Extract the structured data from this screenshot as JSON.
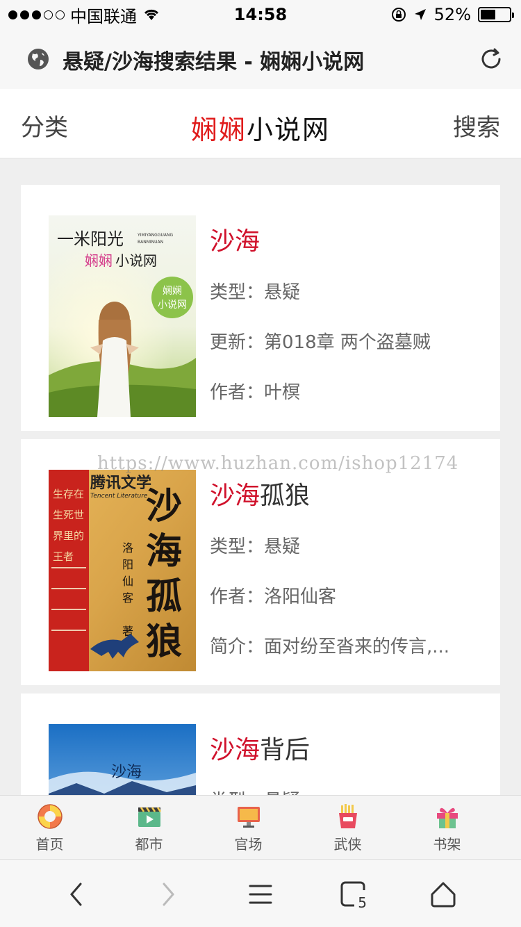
{
  "status_bar": {
    "carrier": "中国联通",
    "time": "14:58",
    "battery": "52%",
    "battery_level": 0.52
  },
  "address_bar": {
    "title": "悬疑/沙海搜索结果 - 娴娴小说网"
  },
  "header": {
    "left_label": "分类",
    "right_label": "搜索",
    "logo_red": "娴娴",
    "logo_black": "小说网"
  },
  "watermark": "https://www.huzhan.com/ishop12174",
  "results": [
    {
      "title_kw": "沙海",
      "title_rest": "",
      "line1": "类型：悬疑",
      "line2": "更新：第018章 两个盗墓贼",
      "line3": "作者：叶榠",
      "cover": {
        "brand_small": "一米阳光",
        "brand_en": "YIMIYANGGUANG BANMINUAN",
        "logo": "娴娴小说网",
        "badge": "娴娴小说网"
      }
    },
    {
      "title_kw": "沙海",
      "title_rest": "孤狼",
      "line1": "类型：悬疑",
      "line2": "作者：洛阳仙客",
      "line3": "简介：面对纷至沓来的传言,...",
      "cover": {
        "publisher": "腾讯文学",
        "publisher_en": "Tencent Literature",
        "big_text": "沙海孤狼",
        "author": "洛阳仙客",
        "author_suffix": "著",
        "side_text": "生存在生死世界里的王者"
      }
    },
    {
      "title_kw": "沙海",
      "title_rest": "背后",
      "line1": "类型：悬疑",
      "cover": {
        "text": "沙海"
      }
    }
  ],
  "tabbar": {
    "items": [
      {
        "label": "首页",
        "icon": "lifebuoy-icon"
      },
      {
        "label": "都市",
        "icon": "film-clapper-icon"
      },
      {
        "label": "官场",
        "icon": "monitor-icon"
      },
      {
        "label": "武侠",
        "icon": "fries-icon"
      },
      {
        "label": "书架",
        "icon": "gift-icon"
      }
    ]
  },
  "safari": {
    "tabs_count": "5"
  },
  "colors": {
    "keyword": "#d0112b",
    "logo_red": "#e01b1b"
  }
}
